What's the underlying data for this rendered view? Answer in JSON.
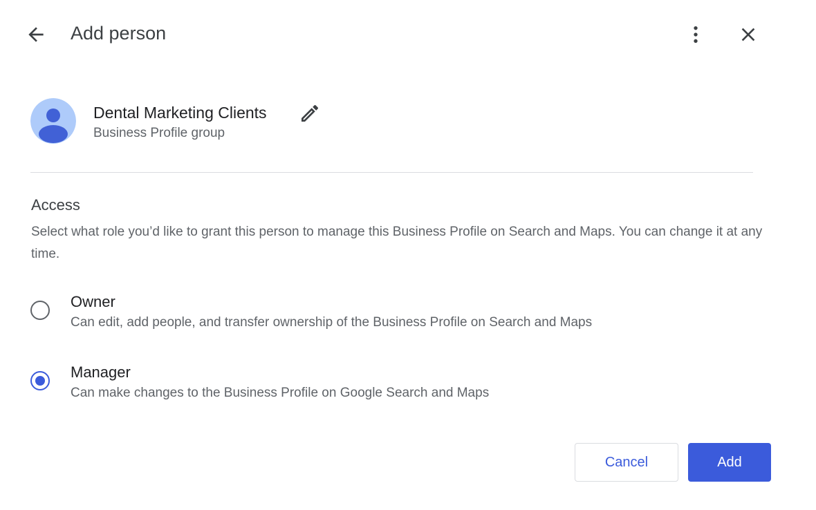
{
  "header": {
    "title": "Add person",
    "back_icon": "arrow-back-icon",
    "more_icon": "more-vert-icon",
    "close_icon": "close-icon"
  },
  "group": {
    "name": "Dental Marketing Clients",
    "subtitle": "Business Profile group",
    "edit_icon": "pencil-icon",
    "avatar_icon": "person-avatar-icon"
  },
  "access": {
    "title": "Access",
    "description": "Select what role you’d like to grant this person to manage this Business Profile on Search and Maps. You can change it at any time.",
    "options": [
      {
        "label": "Owner",
        "description": "Can edit, add people, and transfer ownership of the Business Profile on Search and Maps",
        "selected": false
      },
      {
        "label": "Manager",
        "description": "Can make changes to the Business Profile on Google Search and Maps",
        "selected": true
      }
    ]
  },
  "actions": {
    "cancel_label": "Cancel",
    "add_label": "Add"
  },
  "colors": {
    "accent": "#3b5bdb",
    "avatar_bg": "#aecbfa",
    "avatar_fg": "#4161d6",
    "divider": "#dadce0"
  }
}
